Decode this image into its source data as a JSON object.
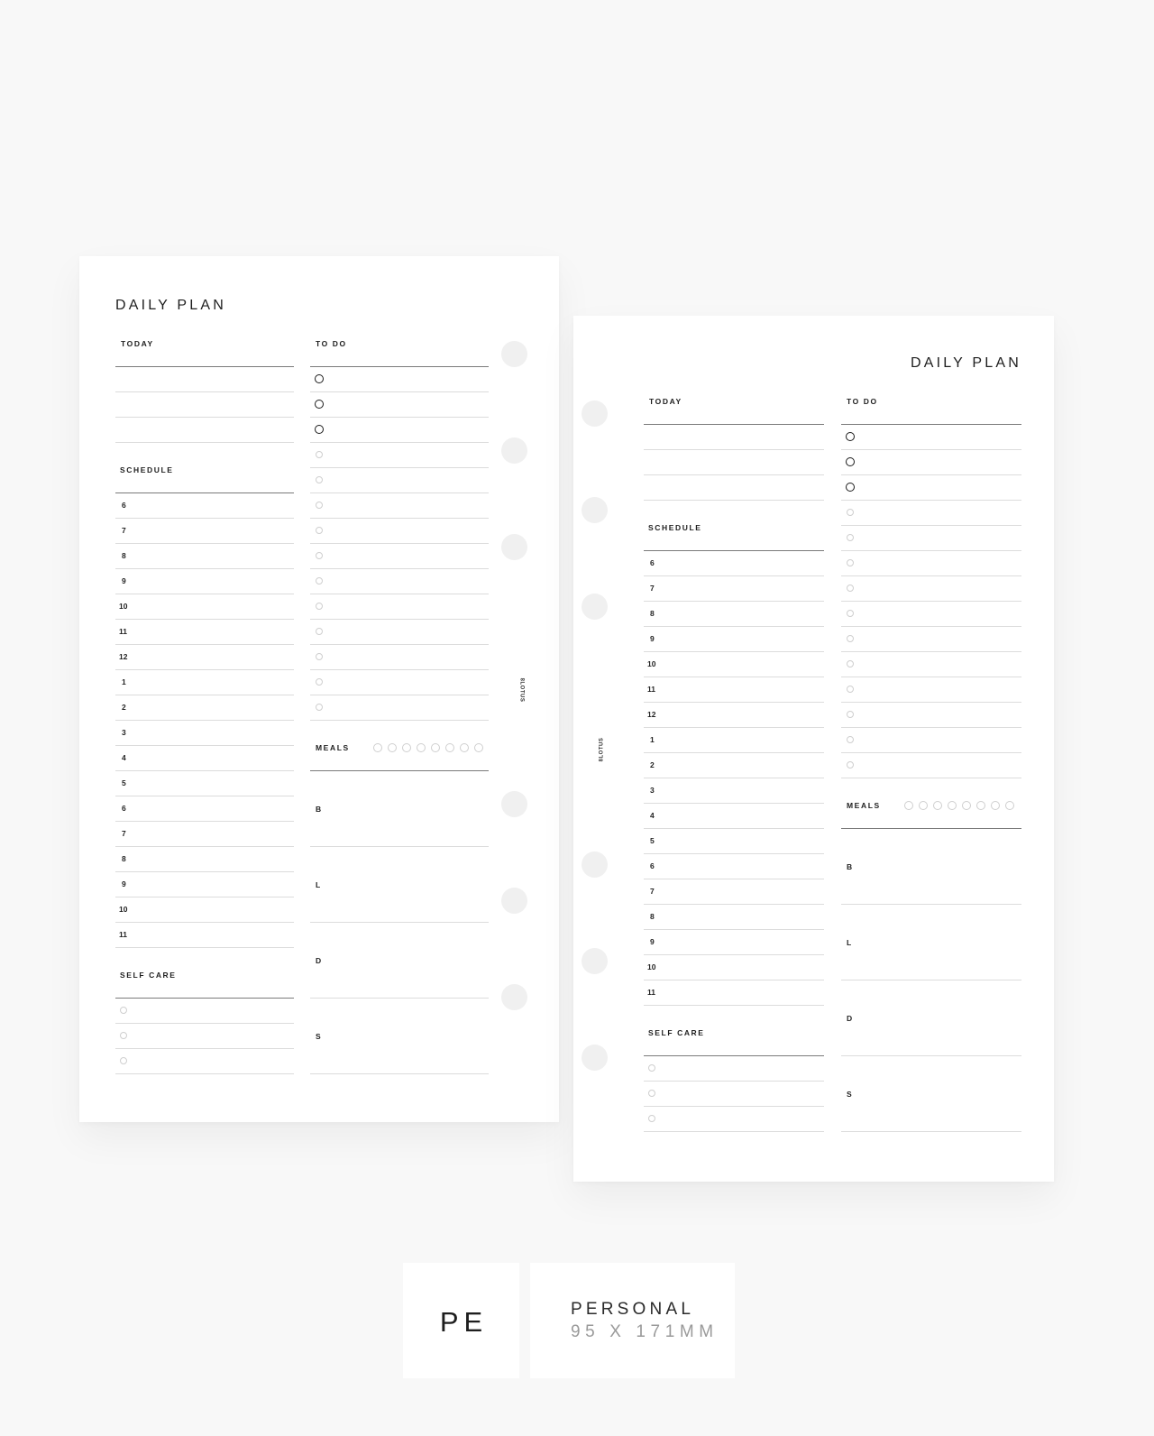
{
  "pages": [
    {
      "id": "left",
      "title": "DAILY PLAN",
      "brand": "8LOTUS",
      "sections": {
        "today": "TODAY",
        "todo": "TO DO",
        "schedule": "SCHEDULE",
        "self_care": "SELF CARE",
        "meals": "MEALS"
      }
    },
    {
      "id": "right",
      "title": "DAILY PLAN",
      "brand": "8LOTUS",
      "sections": {
        "today": "TODAY",
        "todo": "TO DO",
        "schedule": "SCHEDULE",
        "self_care": "SELF CARE",
        "meals": "MEALS"
      }
    }
  ],
  "planner": {
    "today_lines": 3,
    "todo_priority_count": 3,
    "todo_regular_count": 11,
    "schedule_hours": [
      "6",
      "7",
      "8",
      "9",
      "10",
      "11",
      "12",
      "1",
      "2",
      "3",
      "4",
      "5",
      "6",
      "7",
      "8",
      "9",
      "10",
      "11"
    ],
    "self_care_count": 3,
    "meal_tracker_circles": 8,
    "meals": [
      "B",
      "L",
      "D",
      "S"
    ],
    "ring_holes": 6
  },
  "badges": {
    "code": "PE",
    "size_name": "PERSONAL",
    "size_dims": "95 X 171MM"
  },
  "colors": {
    "background": "#f8f8f8",
    "paper": "#ffffff",
    "ink": "#1e1e1e",
    "rule_light": "#dcdcdc",
    "rule_dark": "#7a7a7a",
    "hole": "#f0f0f0",
    "muted": "#9a9a9a"
  }
}
